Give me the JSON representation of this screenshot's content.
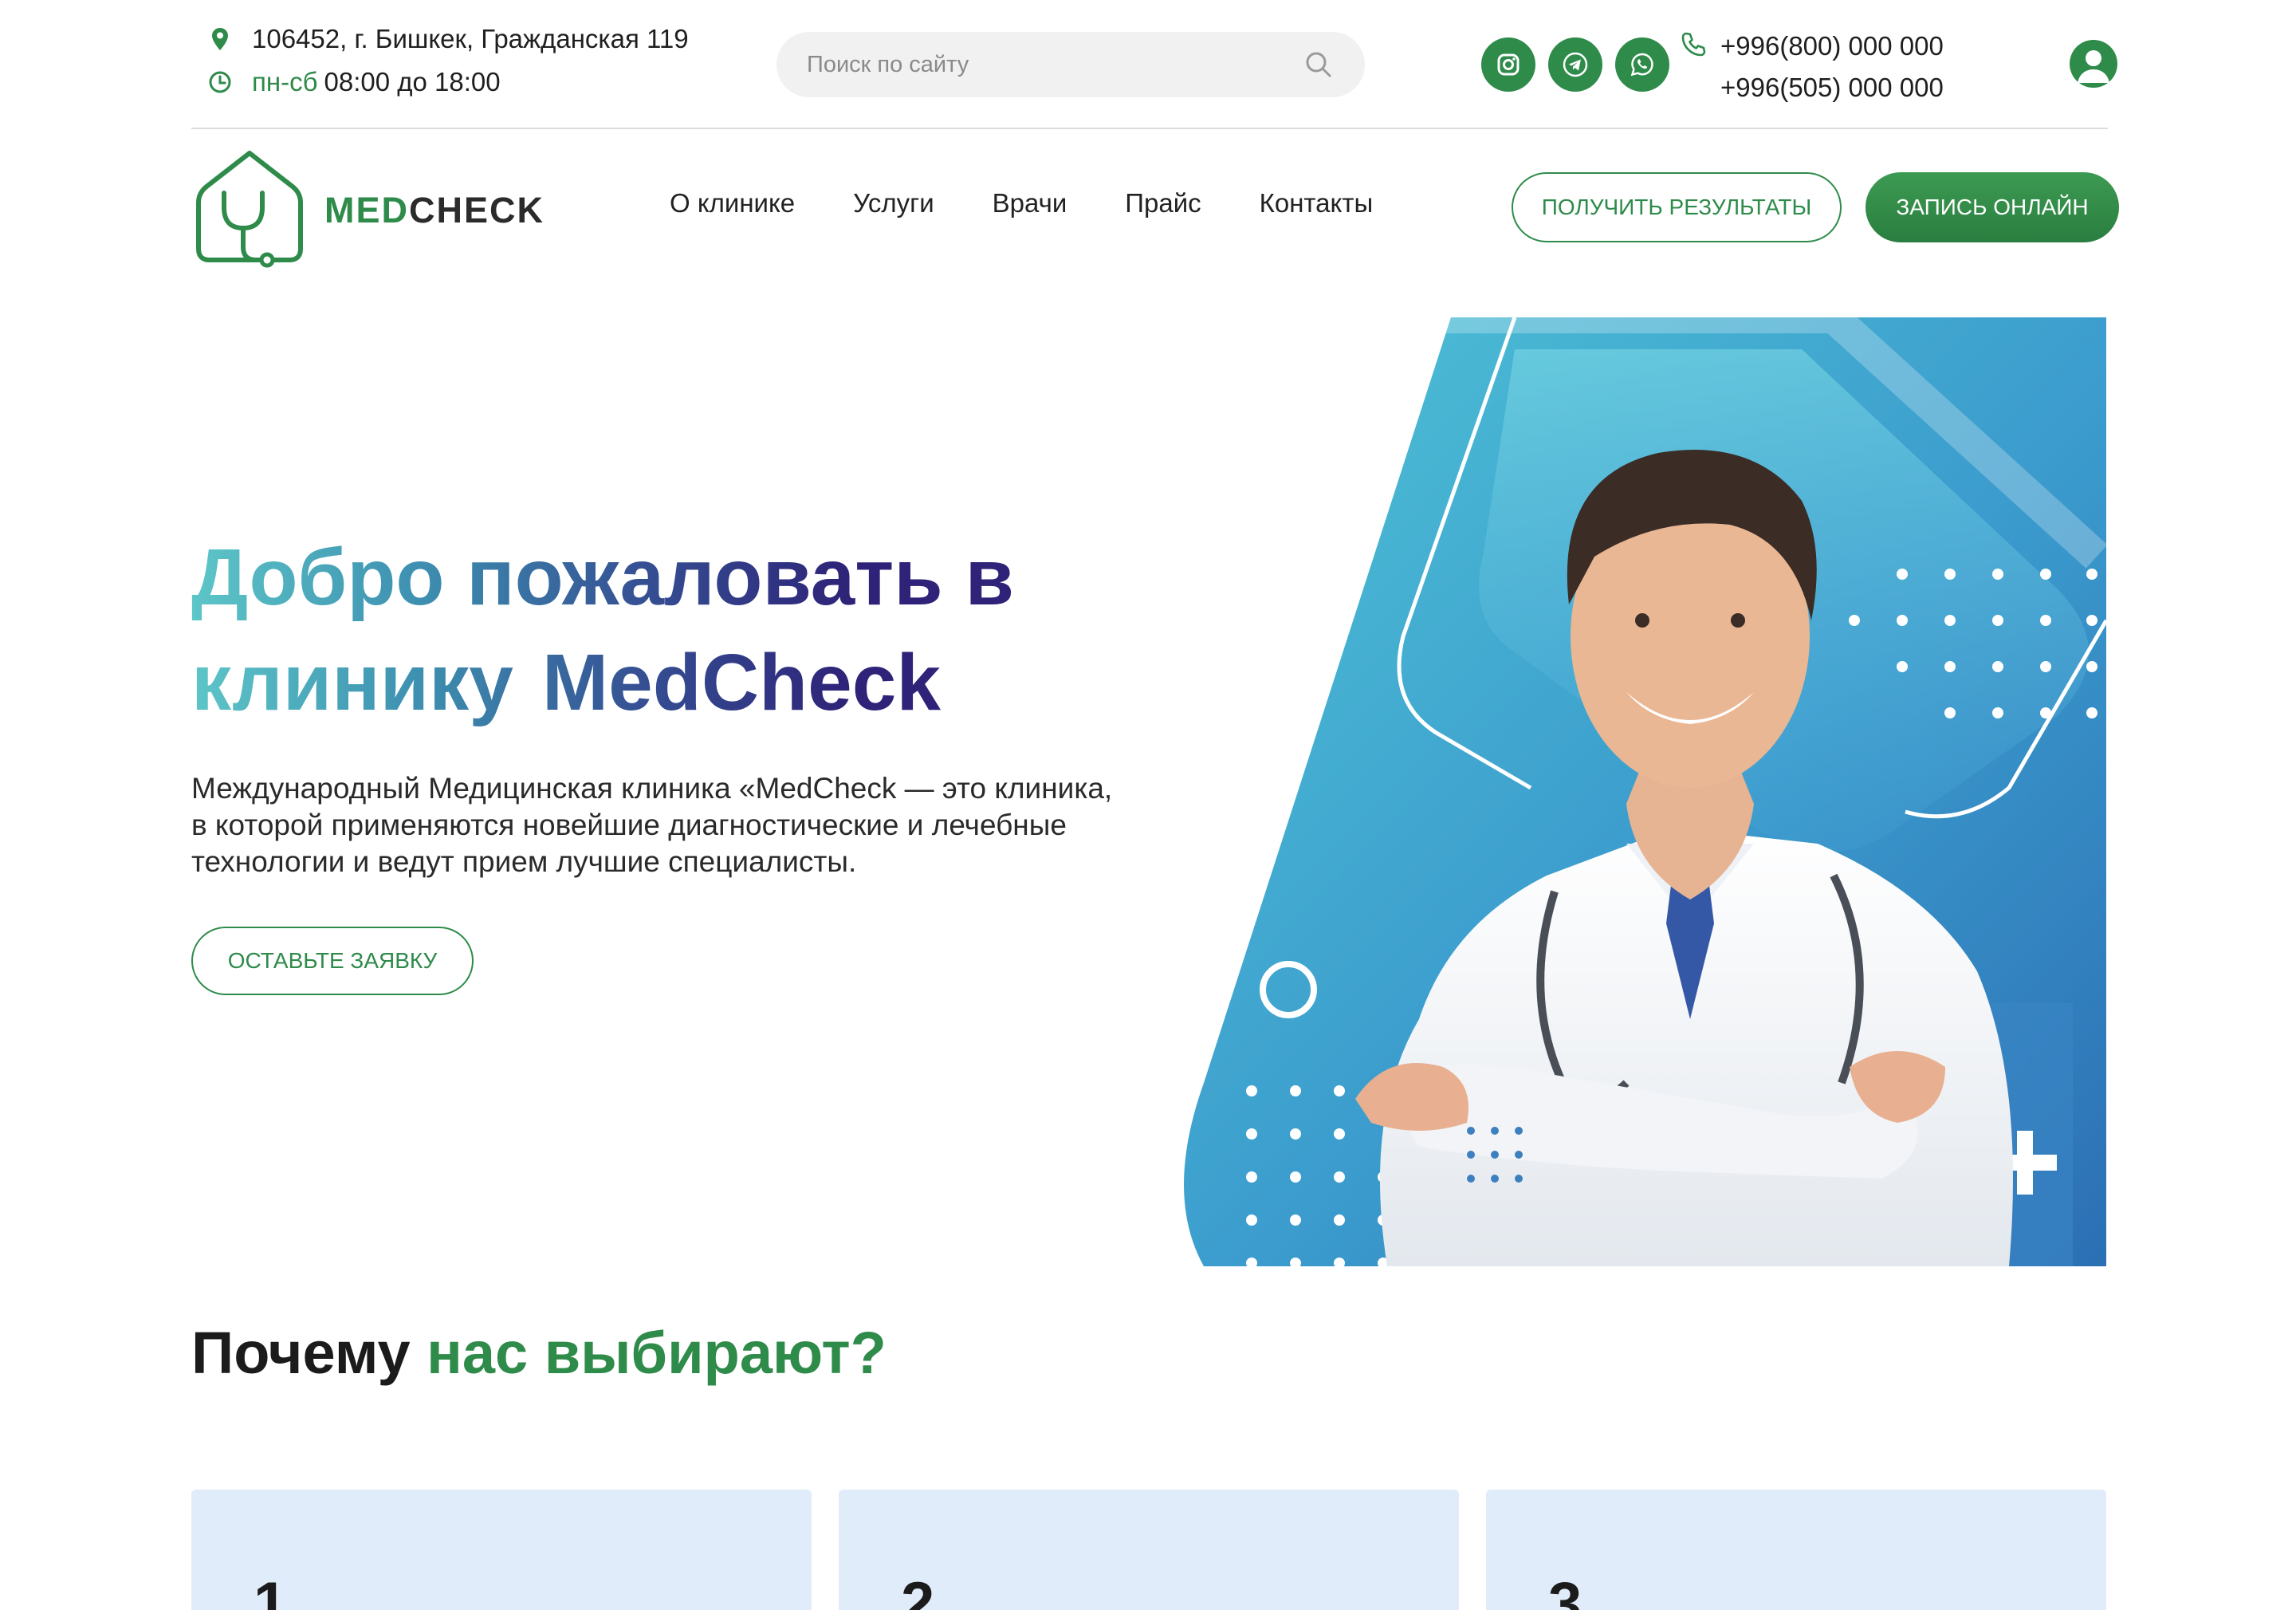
{
  "topbar": {
    "address": "106452, г. Бишкек, Гражданская 119",
    "hours_days": "пн-сб",
    "hours_time": "08:00 до 18:00",
    "search_placeholder": "Поиск по сайту",
    "social": [
      "instagram-icon",
      "telegram-icon",
      "whatsapp-icon"
    ],
    "phones": [
      "+996(800) 000 000",
      "+996(505) 000 000"
    ]
  },
  "header": {
    "logo_med": "MED",
    "logo_check": "CHECK",
    "nav": [
      "О клинике",
      "Услуги",
      "Врачи",
      "Прайс",
      "Контакты"
    ],
    "results_button": "ПОЛУЧИТЬ РЕЗУЛЬТАТЫ",
    "booking_button": "ЗАПИСЬ ОНЛАЙН"
  },
  "hero": {
    "title_line1": "Добро пожаловать в",
    "title_line2": "клинику",
    "title_brand": "MedCheck",
    "description": "Международный Медицинская клиника «MedCheck — это клиника, в которой применяются новейшие диагностические и лечебные технологии и ведут прием лучшие специалисты.",
    "request_button": "ОСТАВЬТЕ ЗАЯВКУ"
  },
  "why": {
    "title_part1": "Почему",
    "title_part2": "нас выбирают?",
    "cards": [
      "1",
      "2",
      "3"
    ]
  },
  "colors": {
    "brand_green": "#2e8b4a",
    "card_bg": "#e1ecfb",
    "hero_blue": "#3a8fc2"
  }
}
